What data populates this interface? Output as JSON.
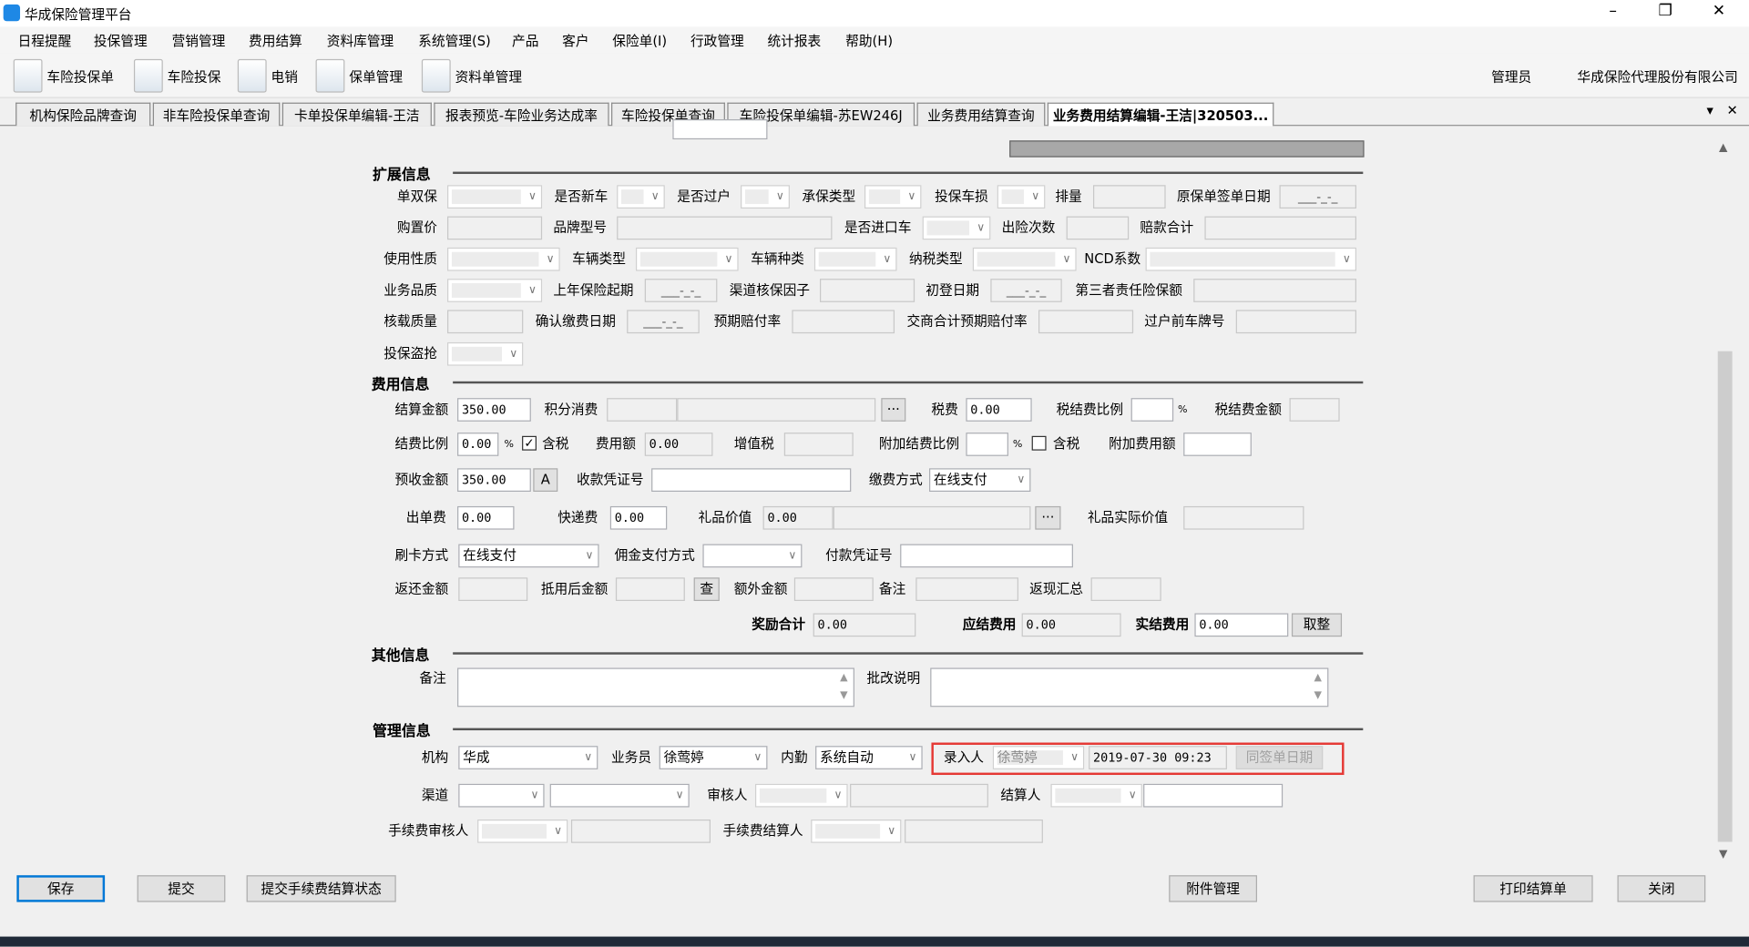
{
  "window": {
    "title": "华成保险管理平台",
    "minimize": "–",
    "restore": "❐",
    "close": "✕"
  },
  "menu": [
    "日程提醒",
    "投保管理",
    "营销管理",
    "费用结算",
    "资料库管理",
    "系统管理(S)",
    "产品",
    "客户",
    "保险单(I)",
    "行政管理",
    "统计报表",
    "帮助(H)"
  ],
  "toolbar": {
    "items": [
      "车险投保单",
      "车险投保",
      "电销",
      "保单管理",
      "资料单管理"
    ],
    "user": "管理员",
    "company": "华成保险代理股份有限公司"
  },
  "tabs": {
    "items": [
      "机构保险品牌查询",
      "非车险投保单查询",
      "卡单投保单编辑-王洁",
      "报表预览-车险业务达成率",
      "车险投保单查询",
      "车险投保单编辑-苏EW246J",
      "业务费用结算查询",
      "业务费用结算编辑-王洁|320503..."
    ],
    "active": 7,
    "menu": "▾",
    "close": "✕"
  },
  "form": {
    "sections": {
      "extended": "扩展信息",
      "fee": "费用信息",
      "other": "其他信息",
      "manage": "管理信息"
    },
    "date_placeholder": "___-_-_",
    "extended": {
      "labels": [
        "单双保",
        "是否新车",
        "是否过户",
        "承保类型",
        "投保车损",
        "排量",
        "原保单签单日期",
        "购置价",
        "品牌型号",
        "是否进口车",
        "出险次数",
        "赔款合计",
        "使用性质",
        "车辆类型",
        "车辆种类",
        "纳税类型",
        "NCD系数",
        "业务品质",
        "上年保险起期",
        "渠道核保因子",
        "初登日期",
        "第三者责任险保额",
        "核载质量",
        "确认缴费日期",
        "预期赔付率",
        "交商合计预期赔付率",
        "过户前车牌号",
        "投保盗抢"
      ]
    },
    "fee": {
      "labels": [
        "结算金额",
        "积分消费",
        "税费",
        "税结费比例",
        "税结费金额",
        "结费比例",
        "含税",
        "费用额",
        "增值税",
        "附加结费比例",
        "含税",
        "附加费用额",
        "预收金额",
        "收款凭证号",
        "缴费方式",
        "出单费",
        "快递费",
        "礼品价值",
        "礼品实际价值",
        "刷卡方式",
        "佣金支付方式",
        "付款凭证号",
        "返还金额",
        "抵用后金额",
        "额外金额",
        "备注",
        "返现汇总",
        "奖励合计",
        "应结费用",
        "实结费用"
      ],
      "values": {
        "settle_amount": "350.00",
        "tax": "0.00",
        "fee_ratio": "0.00",
        "fee_amount": "0.00",
        "prepaid": "350.00",
        "pay_method": "在线支付",
        "issue_fee": "0.00",
        "courier_fee": "0.00",
        "gift_value": "0.00",
        "card_method": "在线支付",
        "reward_total": "0.00",
        "payable": "0.00",
        "actual": "0.00"
      },
      "percent": "%",
      "buttons": {
        "ellipsis": "···",
        "a": "A",
        "query": "查",
        "round": "取整"
      },
      "checks": {
        "tax_included_1": true,
        "tax_included_2": false
      }
    },
    "other": {
      "labels": [
        "备注",
        "批改说明"
      ]
    },
    "manage": {
      "labels": [
        "机构",
        "业务员",
        "内勤",
        "录入人",
        "渠道",
        "审核人",
        "结算人",
        "手续费审核人",
        "手续费结算人"
      ],
      "values": {
        "org": "华成",
        "salesman": "徐莺婷",
        "clerk": "系统自动",
        "entered_by": "徐莺婷",
        "entry_time": "2019-07-30 09:23",
        "same_date_button": "同签单日期"
      }
    }
  },
  "footer": {
    "save": "保存",
    "submit": "提交",
    "submit_fee_status": "提交手续费结算状态",
    "attachments": "附件管理",
    "print": "打印结算单",
    "close": "关闭"
  }
}
